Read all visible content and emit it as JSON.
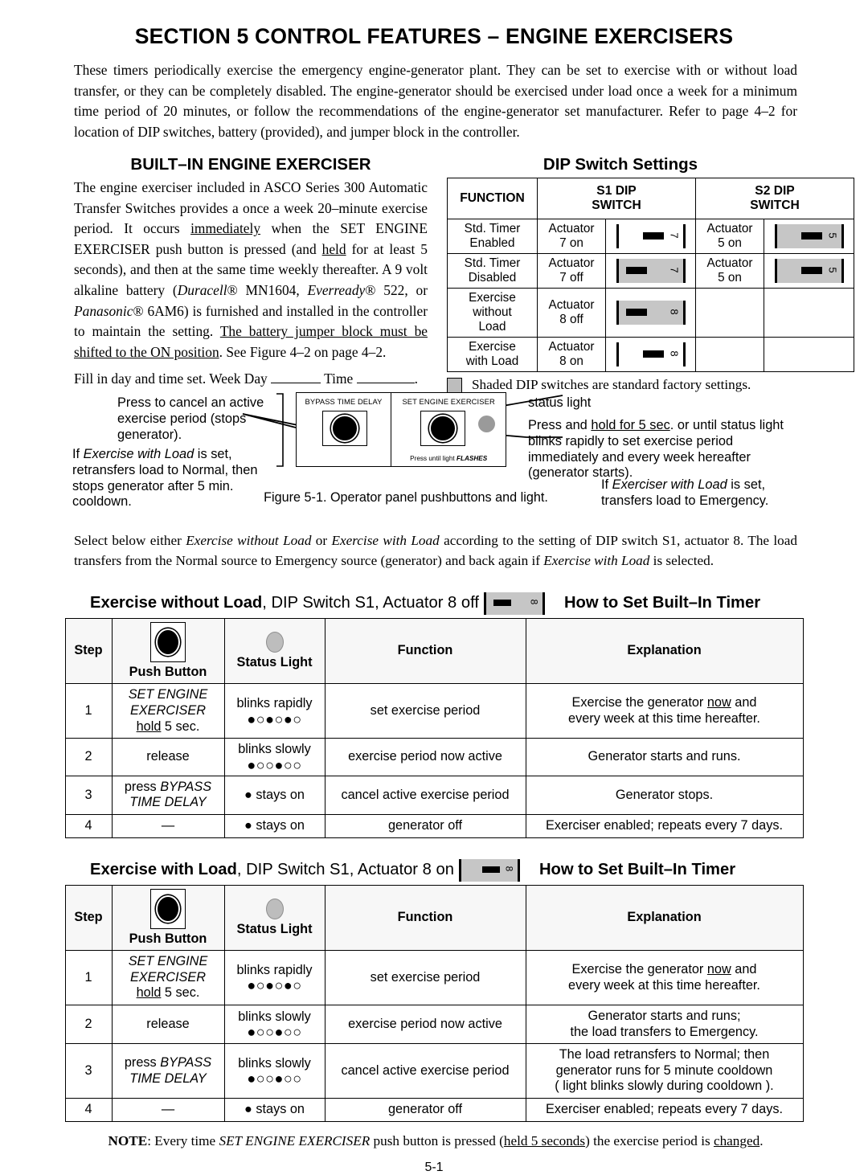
{
  "title": "SECTION 5  CONTROL FEATURES – ENGINE EXERCISERS",
  "intro": "These timers periodically exercise the emergency engine-generator plant.  They can be set to exercise with or without load transfer, or they can be completely disabled.  The engine-generator should be exercised under load once a week for a minimum time period of 20 minutes, or follow the recommendations of the engine-generator set manufacturer.  Refer to page 4–2 for location of DIP switches, battery (provided), and jumper block in the controller.",
  "left_column": {
    "heading": "BUILT–IN ENGINE EXERCISER",
    "fill_in": {
      "prefix": "Fill in day and time set. Week Day",
      "middle": "Time",
      "suffix": "."
    }
  },
  "dip_settings": {
    "heading": "DIP Switch Settings",
    "columns": [
      "FUNCTION",
      "S1 DIP SWITCH",
      "S2 DIP SWITCH"
    ],
    "col_function": "FUNCTION",
    "col_s1_line1": "S1 DIP",
    "col_s1_line2": "SWITCH",
    "col_s2_line1": "S2 DIP",
    "col_s2_line2": "SWITCH",
    "rows": [
      {
        "function": "Std. Timer Enabled",
        "s1_actuator": "Actuator 7 on",
        "s1_switch": {
          "number": "7",
          "state": "on",
          "shaded": false,
          "present": true
        },
        "s2_actuator": "Actuator 5 on",
        "s2_switch": {
          "number": "5",
          "state": "on",
          "shaded": true,
          "present": true
        }
      },
      {
        "function": "Std. Timer Disabled",
        "s1_actuator": "Actuator 7 off",
        "s1_switch": {
          "number": "7",
          "state": "off",
          "shaded": true,
          "present": true
        },
        "s2_actuator": "Actuator 5 on",
        "s2_switch": {
          "number": "5",
          "state": "on",
          "shaded": true,
          "present": true
        }
      },
      {
        "function": "Exercise without Load",
        "s1_actuator": "Actuator 8 off",
        "s1_switch": {
          "number": "8",
          "state": "off",
          "shaded": true,
          "present": true
        },
        "s2_actuator": "",
        "s2_switch": {
          "number": "",
          "state": "off",
          "shaded": false,
          "present": false
        }
      },
      {
        "function": "Exercise with Load",
        "s1_actuator": "Actuator 8 on",
        "s1_switch": {
          "number": "8",
          "state": "on",
          "shaded": false,
          "present": true
        },
        "s2_actuator": "",
        "s2_switch": {
          "number": "",
          "state": "off",
          "shaded": false,
          "present": false
        }
      }
    ],
    "legend": "Shaded DIP switches are standard factory settings.",
    "shaded_color": "#c6c6c6"
  },
  "figure": {
    "caption": "Figure 5-1. Operator panel pushbuttons and light.",
    "panel": {
      "left_label": "BYPASS TIME DELAY",
      "right_label": "SET ENGINE EXERCISER",
      "press_until_prefix": "Press until light ",
      "press_until_emphasis": "FLASHES"
    },
    "annotations": {
      "left_top": "Press to cancel an active exercise period (stops generator).",
      "left_bottom_line1": "If ",
      "left_bottom_italic": "Exercise with Load",
      "left_bottom_line2": " is set, retransfers load to Normal, then stops generator after 5 min. cooldown.",
      "status_light_label": "status light",
      "right_main_a": "Press and ",
      "right_main_underline": "hold for 5 sec",
      "right_main_b": ". or until status light blinks rapidly to set exercise period immediately and every week hereafter (generator starts).",
      "right_sub_a": "If ",
      "right_sub_italic": "Exerciser with Load",
      "right_sub_b": " is set, transfers load to Emergency."
    }
  },
  "select_paragraph": {
    "a": "Select below either ",
    "i1": "Exercise without Load",
    "b": " or ",
    "i2": "Exercise with Load",
    "c": " according to the setting of DIP switch S1, actuator 8. The load transfers from the Normal source to Emergency source (generator) and back again if ",
    "i3": "Exercise with Load",
    "d": " is selected."
  },
  "sections": [
    {
      "heading_bold": "Exercise without Load",
      "heading_rest": ", DIP Switch S1, Actuator 8 off",
      "switch": {
        "number": "8",
        "state": "off",
        "shaded": true
      },
      "how_to": "How to Set Built–In Timer",
      "table": {
        "headers": {
          "step": "Step",
          "push_button": "Push Button",
          "status_light": "Status Light",
          "function": "Function",
          "explanation": "Explanation"
        },
        "rows": [
          {
            "step": "1",
            "push_button_lines": [
              "SET ENGINE",
              "EXERCISER",
              "hold 5 sec."
            ],
            "push_button_style": "italic-first-two-underline-hold",
            "status_text": "blinks rapidly",
            "status_pattern": "●○●○●○",
            "function": "set exercise period",
            "explanation_lines": [
              "Exercise the generator now and",
              "every week at this time hereafter."
            ],
            "explanation_underline": "now"
          },
          {
            "step": "2",
            "push_button_lines": [
              "release"
            ],
            "status_text": "blinks slowly",
            "status_pattern": "●○○●○○",
            "function": "exercise period now active",
            "explanation_lines": [
              "Generator starts and runs."
            ]
          },
          {
            "step": "3",
            "push_button_lines": [
              "press BYPASS",
              "TIME DELAY"
            ],
            "status_text": "● stays on",
            "status_pattern": "",
            "function": "cancel active exercise period",
            "explanation_lines": [
              "Generator stops."
            ]
          },
          {
            "step": "4",
            "push_button_lines": [
              "—"
            ],
            "status_text": "● stays on",
            "status_pattern": "",
            "function": "generator off",
            "explanation_lines": [
              "Exerciser enabled; repeats every 7 days."
            ]
          }
        ]
      }
    },
    {
      "heading_bold": "Exercise with Load",
      "heading_rest": ", DIP Switch S1, Actuator 8 on",
      "switch": {
        "number": "8",
        "state": "on",
        "shaded": true
      },
      "how_to": "How to Set Built–In Timer",
      "table": {
        "headers": {
          "step": "Step",
          "push_button": "Push Button",
          "status_light": "Status Light",
          "function": "Function",
          "explanation": "Explanation"
        },
        "rows": [
          {
            "step": "1",
            "push_button_lines": [
              "SET ENGINE",
              "EXERCISER",
              "hold 5 sec."
            ],
            "status_text": "blinks rapidly",
            "status_pattern": "●○●○●○",
            "function": "set exercise period",
            "explanation_lines": [
              "Exercise the generator now and",
              "every week at this time hereafter."
            ],
            "explanation_underline": "now"
          },
          {
            "step": "2",
            "push_button_lines": [
              "release"
            ],
            "status_text": "blinks slowly",
            "status_pattern": "●○○●○○",
            "function": "exercise period now active",
            "explanation_lines": [
              "Generator starts and runs;",
              "the load transfers to Emergency."
            ]
          },
          {
            "step": "3",
            "push_button_lines": [
              "press BYPASS",
              "TIME DELAY"
            ],
            "status_text": "blinks slowly",
            "status_pattern": "●○○●○○",
            "function": "cancel active exercise period",
            "explanation_lines": [
              "The load retransfers to Normal; then",
              "generator runs for 5 minute cooldown",
              "( light blinks slowly during cooldown )."
            ]
          },
          {
            "step": "4",
            "push_button_lines": [
              "—"
            ],
            "status_text": "● stays on",
            "status_pattern": "",
            "function": "generator off",
            "explanation_lines": [
              "Exerciser enabled; repeats every 7 days."
            ]
          }
        ]
      }
    }
  ],
  "note": {
    "label": "NOTE",
    "a": ": Every time ",
    "italic": "SET ENGINE EXERCISER",
    "b": " push button is pressed (",
    "underline1": "held 5 seconds",
    "c": ") the exercise period is ",
    "underline2": "changed",
    "d": "."
  },
  "page_number": "5-1"
}
